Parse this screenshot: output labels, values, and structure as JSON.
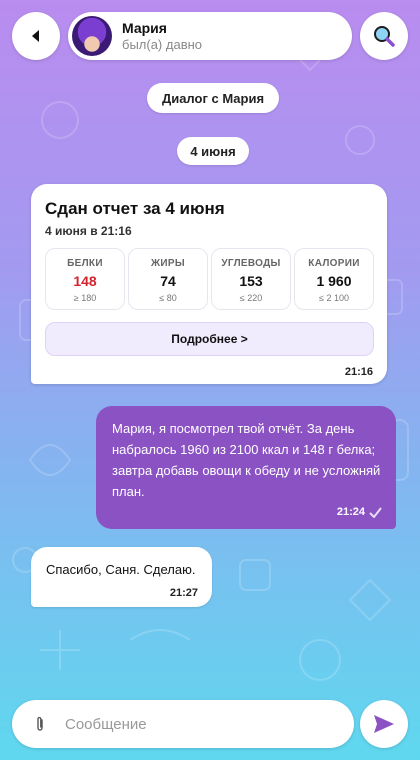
{
  "header": {
    "contact_name": "Мария",
    "contact_status": "был(а) давно"
  },
  "chat": {
    "dialog_chip": "Диалог с Мария",
    "date_chip": "4 июня"
  },
  "report": {
    "title": "Сдан отчет за 4 июня",
    "subtitle": "4 июня в 21:16",
    "stats": [
      {
        "label": "БЕЛКИ",
        "value": "148",
        "limit": "≥ 180",
        "over": true
      },
      {
        "label": "ЖИРЫ",
        "value": "74",
        "limit": "≤ 80",
        "over": false
      },
      {
        "label": "УГЛЕВОДЫ",
        "value": "153",
        "limit": "≤ 220",
        "over": false
      },
      {
        "label": "КАЛОРИИ",
        "value": "1 960",
        "limit": "≤ 2 100",
        "over": false
      }
    ],
    "more_label": "Подробнее >",
    "time": "21:16"
  },
  "outgoing": {
    "text": "Мария, я посмотрел твой отчёт. За день набралось 1960 из 2100 ккал и 148 г белка; завтра добавь овощи к обеду и не усложняй план.",
    "time": "21:24",
    "status_icon": "check-icon"
  },
  "incoming": {
    "text": "Спасибо, Саня. Сделаю.",
    "time": "21:27"
  },
  "composer": {
    "placeholder": "Сообщение"
  },
  "colors": {
    "accent": "#8b52c4",
    "over_limit": "#d3242e",
    "send_icon": "#8b52c4"
  }
}
